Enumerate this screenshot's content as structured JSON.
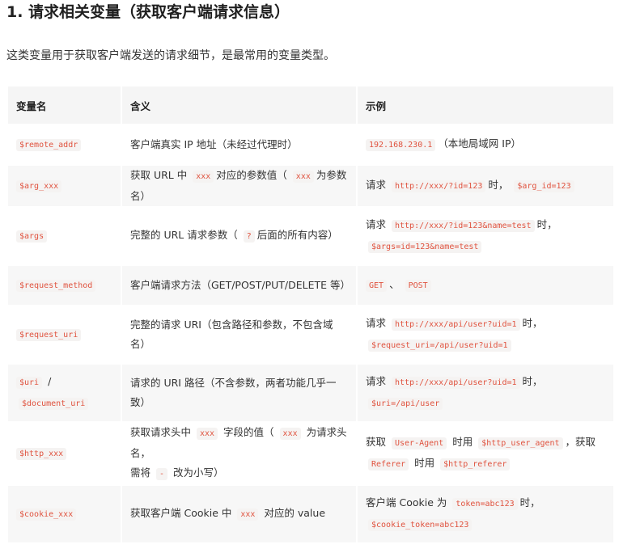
{
  "heading": "1. 请求相关变量（获取客户端请求信息）",
  "intro": "这类变量用于获取客户端发送的请求细节，是最常用的变量类型。",
  "table": {
    "headers": [
      "变量名",
      "含义",
      "示例"
    ],
    "rows": [
      {
        "name": [
          "$remote_addr"
        ],
        "meaning": "客户端真实 IP 地址（未经过代理时）",
        "example": [
          "192.168.230.1",
          "（本地局域网 IP）"
        ]
      },
      {
        "name": [
          "$arg_xxx"
        ],
        "meaning": [
          "获取 URL 中",
          "xxx",
          "对应的参数值（",
          "xxx",
          "为参数名）"
        ],
        "example": [
          "请求",
          "http://xxx/?id=123",
          "时，",
          "$arg_id=123"
        ]
      },
      {
        "name": [
          "$args"
        ],
        "meaning": [
          "完整的 URL 请求参数（",
          "?",
          "后面的所有内容）"
        ],
        "example": [
          "请求",
          "http://xxx/?id=123&name=test",
          "时，",
          "$args=id=123&name=test"
        ]
      },
      {
        "name": [
          "$request_method"
        ],
        "meaning": "客户端请求方法（GET/POST/PUT/DELETE 等）",
        "example": [
          "GET",
          "、",
          "POST"
        ]
      },
      {
        "name": [
          "$request_uri"
        ],
        "meaning": "完整的请求 URI（包含路径和参数，不包含域名）",
        "example": [
          "请求",
          "http://xxx/api/user?uid=1",
          "时，",
          "$request_uri=/api/user?uid=1"
        ]
      },
      {
        "name": [
          "$uri",
          "/",
          "$document_uri"
        ],
        "meaning": "请求的 URI 路径（不含参数，两者功能几乎一致）",
        "example": [
          "请求",
          "http://xxx/api/user?uid=1",
          "时，",
          "$uri=/api/user"
        ]
      },
      {
        "name": [
          "$http_xxx"
        ],
        "meaning": [
          "获取请求头中",
          "xxx",
          "字段的值（",
          "xxx",
          "为请求头名，",
          "需将",
          "-",
          "改为小写）"
        ],
        "example": [
          "获取",
          "User-Agent",
          "时用",
          "$http_user_agent",
          "，获取",
          "Referer",
          "时用",
          "$http_referer"
        ]
      },
      {
        "name": [
          "$cookie_xxx"
        ],
        "meaning": [
          "获取客户端 Cookie 中",
          "xxx",
          "对应的 value"
        ],
        "example": [
          "客户端 Cookie 为",
          "token=abc123",
          "时，",
          "$cookie_token=abc123"
        ]
      }
    ]
  }
}
